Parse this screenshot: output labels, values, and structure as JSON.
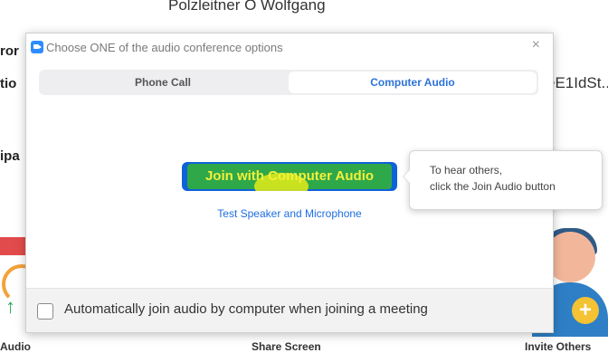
{
  "background": {
    "top_text": "Polzleitner O Wolfgang",
    "left_fragments": [
      "ror",
      "tio",
      "ipa"
    ],
    "right_fragment": "eE1IdSt...",
    "bottom_labels": [
      "Audio",
      "Share Screen",
      "Invite Others"
    ]
  },
  "dialog": {
    "title": "Choose ONE of the audio conference options",
    "close_glyph": "×",
    "tabs": [
      {
        "label": "Phone Call",
        "active": false
      },
      {
        "label": "Computer Audio",
        "active": true
      }
    ],
    "join_button_label": "Join with Computer Audio",
    "test_link_label": "Test Speaker and Microphone",
    "auto_join_label": "Automatically join audio by computer when joining a meeting",
    "auto_join_checked": false
  },
  "tooltip": {
    "line1": "To hear others,",
    "line2": "click the Join Audio button"
  },
  "colors": {
    "accent": "#2d74da",
    "join_button": "#0e62d8",
    "highlight_green": "#2fa84a",
    "highlight_yellow": "#d9e81c"
  },
  "icons": [
    "zoom-logo-icon",
    "close-icon",
    "checkbox-icon",
    "avatar-icon",
    "add-icon",
    "arrow-up-icon"
  ]
}
